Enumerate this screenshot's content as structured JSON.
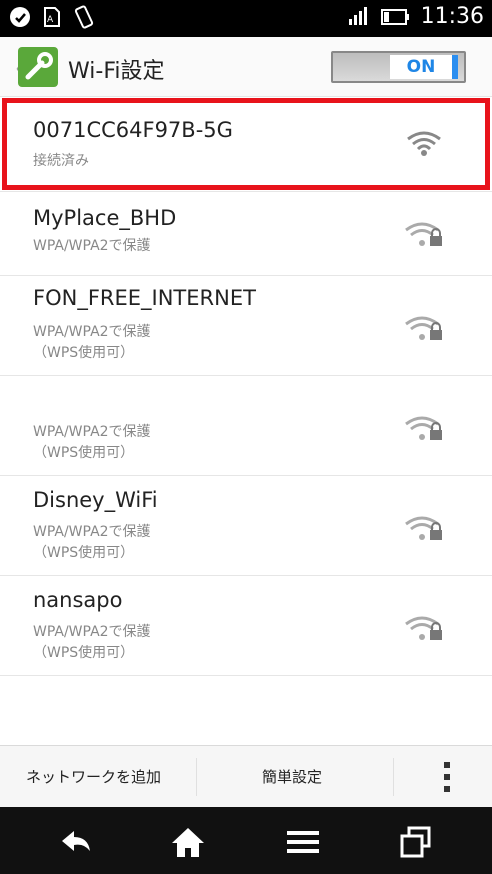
{
  "status_bar": {
    "time": "11:36",
    "icons_left": [
      "notification-icon",
      "sim-icon",
      "rotate-icon"
    ],
    "icons_right": [
      "signal-icon",
      "battery-icon"
    ]
  },
  "action_bar": {
    "back_glyph": "〈",
    "title": "Wi-Fi設定",
    "toggle_label": "ON",
    "toggle_state": "on"
  },
  "networks": [
    {
      "name": "0071CC64F97B-5G",
      "status": [
        "接続済み"
      ],
      "secured": false,
      "selected": true
    },
    {
      "name": "MyPlace_BHD",
      "status": [
        "WPA/WPA2で保護"
      ],
      "secured": true,
      "selected": false
    },
    {
      "name": "FON_FREE_INTERNET",
      "status": [
        "WPA/WPA2で保護",
        "（WPS使用可）"
      ],
      "secured": true,
      "selected": false
    },
    {
      "name": "",
      "status": [
        "WPA/WPA2で保護",
        "（WPS使用可）"
      ],
      "secured": true,
      "selected": false
    },
    {
      "name": "Disney_WiFi",
      "status": [
        "WPA/WPA2で保護",
        "（WPS使用可）"
      ],
      "secured": true,
      "selected": false
    },
    {
      "name": "nansapo",
      "status": [
        "WPA/WPA2で保護",
        "（WPS使用可）"
      ],
      "secured": true,
      "selected": false
    }
  ],
  "toolbar": {
    "add_network": "ネットワークを追加",
    "easy_setup": "簡単設定"
  },
  "colors": {
    "highlight": "#e8131b",
    "toggle_accent": "#2b8ef0",
    "app_icon": "#5aa83a"
  }
}
